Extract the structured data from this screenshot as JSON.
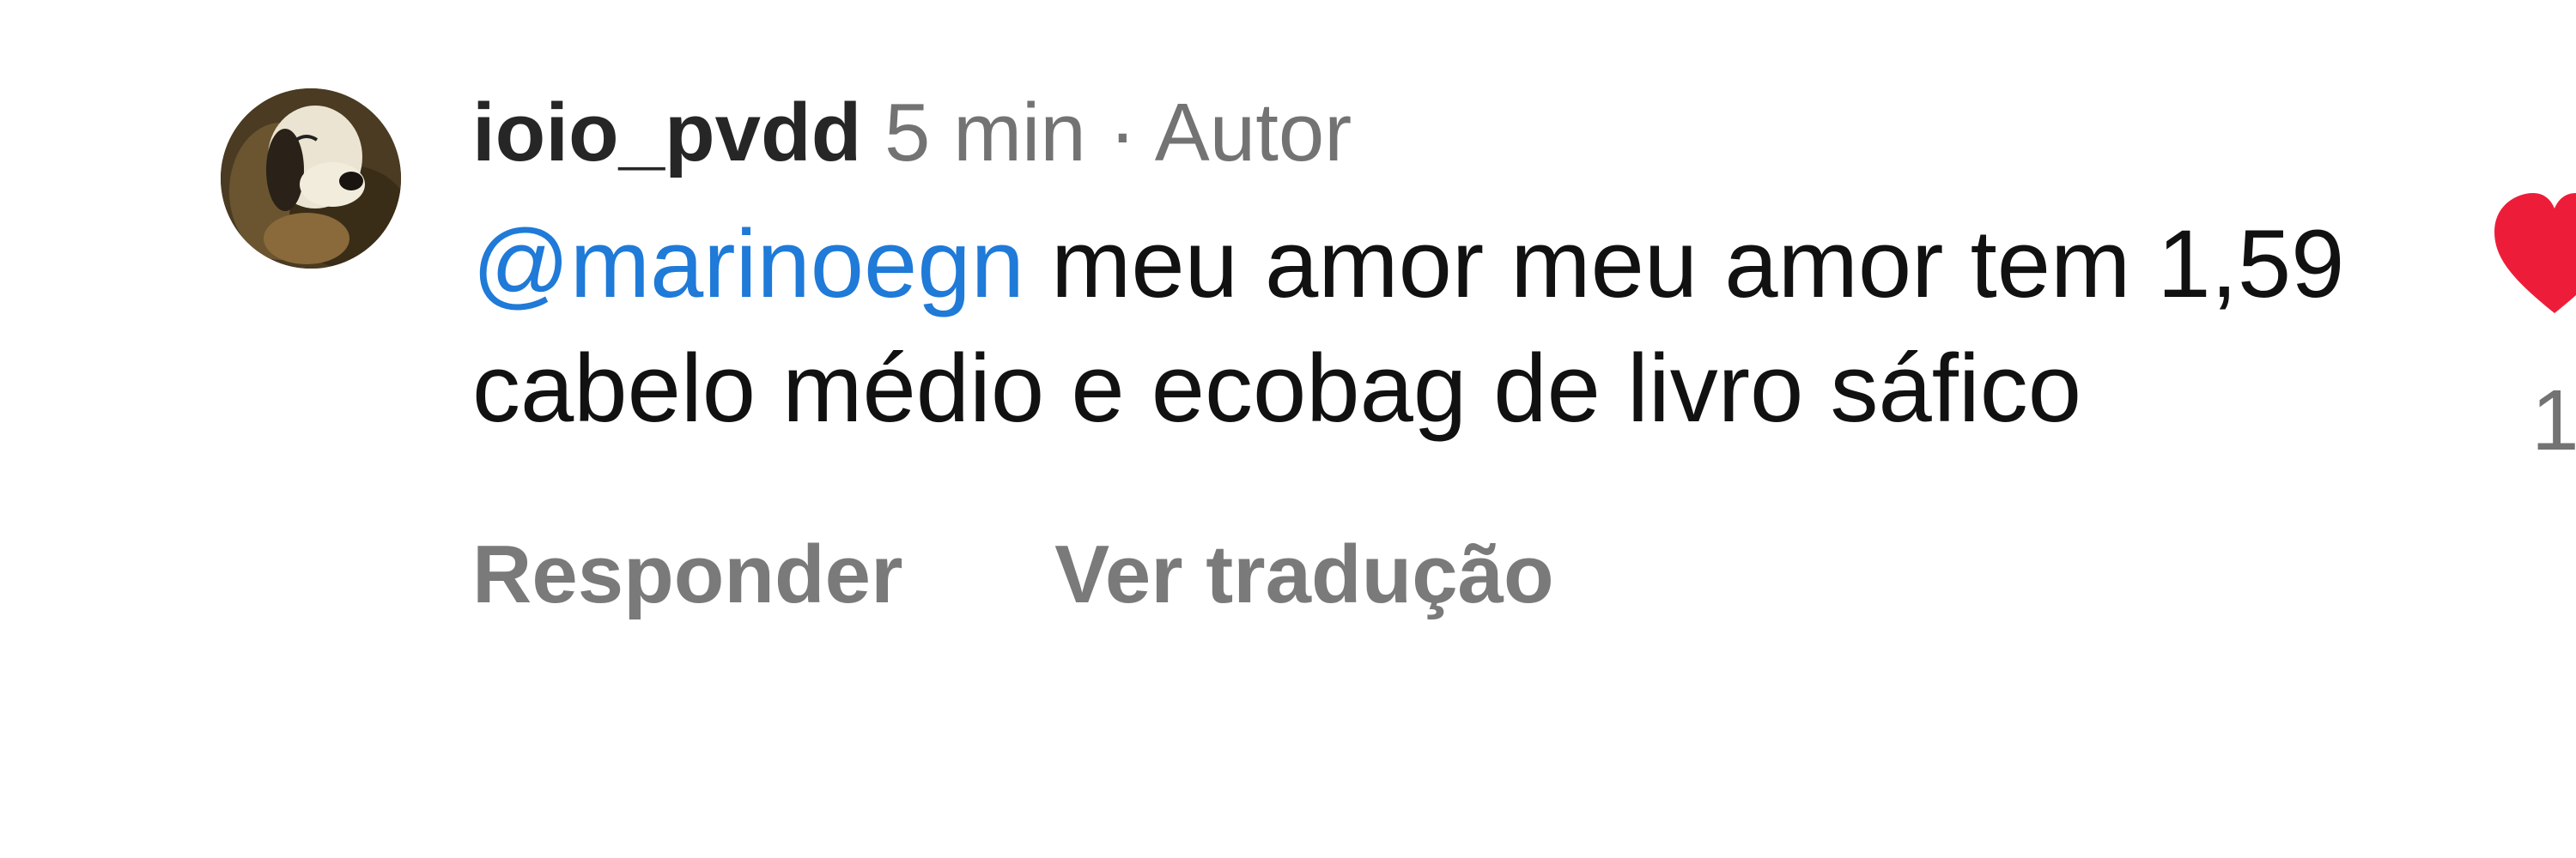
{
  "comment": {
    "username": "ioio_pvdd",
    "time": "5 min",
    "separator": "·",
    "author_tag": "Autor",
    "mention": "@marinoegn",
    "text": " meu amor meu amor tem 1,59 cabelo médio e ecobag de livro sáfico",
    "reply_label": "Responder",
    "translate_label": "Ver tradução",
    "like_count": "1",
    "like_icon": "heart-icon",
    "like_color": "#ed1d3a",
    "mention_color": "#1f7ad8"
  }
}
